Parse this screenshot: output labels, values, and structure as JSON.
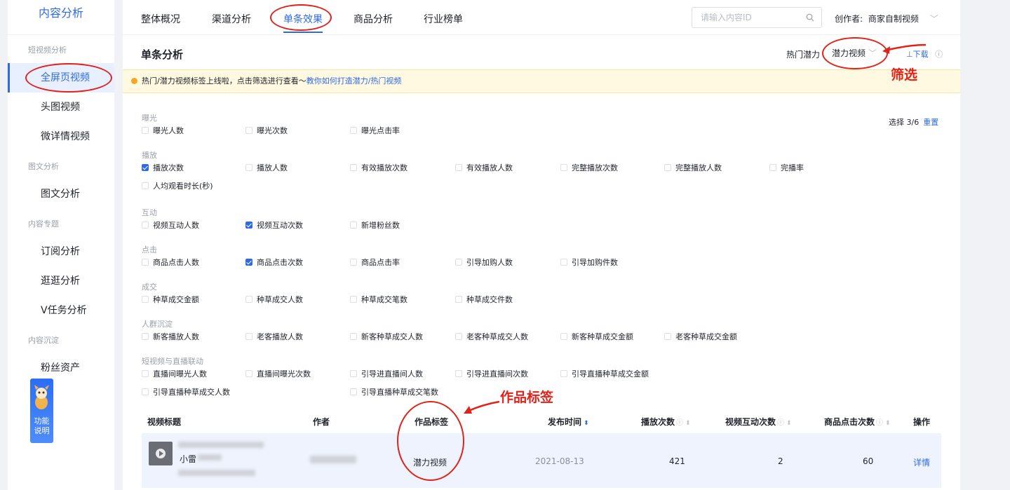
{
  "sidebar": {
    "title": "内容分析",
    "groups": [
      {
        "label": "短视频分析",
        "items": [
          "全屏页视频",
          "头图视频",
          "微详情视频"
        ]
      },
      {
        "label": "图文分析",
        "items": [
          "图文分析"
        ]
      },
      {
        "label": "内容专题",
        "items": [
          "订阅分析",
          "逛逛分析",
          "V任务分析"
        ]
      },
      {
        "label": "内容沉淀",
        "items": [
          "粉丝资产"
        ]
      }
    ],
    "active_item": "全屏页视频",
    "help_label": "功能\n说明"
  },
  "topnav": {
    "tabs": [
      "整体概况",
      "渠道分析",
      "单条效果",
      "商品分析",
      "行业榜单"
    ],
    "active_tab": "单条效果",
    "search_placeholder": "请输入内容ID",
    "creator_label": "创作者:",
    "creator_value": "商家自制视频"
  },
  "section": {
    "title": "单条分析",
    "hot_label": "热门潜力",
    "hot_value": "潜力视频",
    "download_label": "下载"
  },
  "notice": {
    "text": "热门/潜力视频标签上线啦，点击筛选进行查看～",
    "link": "教你如何打造潜力/热门视频"
  },
  "filters": {
    "select_count": "选择 3/6",
    "reset": "重置",
    "groups": [
      {
        "label": "曝光",
        "options": [
          [
            "曝光人数",
            false
          ],
          [
            "曝光次数",
            false
          ],
          [
            "曝光点击率",
            false
          ]
        ]
      },
      {
        "label": "播放",
        "options": [
          [
            "播放次数",
            true
          ],
          [
            "播放人数",
            false
          ],
          [
            "有效播放次数",
            false
          ],
          [
            "有效播放人数",
            false
          ],
          [
            "完整播放次数",
            false
          ],
          [
            "完整播放人数",
            false
          ],
          [
            "完播率",
            false
          ],
          [
            "人均观看时长(秒)",
            false
          ]
        ]
      },
      {
        "label": "互动",
        "options": [
          [
            "视频互动人数",
            false
          ],
          [
            "视频互动次数",
            true
          ],
          [
            "新增粉丝数",
            false
          ]
        ]
      },
      {
        "label": "点击",
        "options": [
          [
            "商品点击人数",
            false
          ],
          [
            "商品点击次数",
            true
          ],
          [
            "商品点击率",
            false
          ],
          [
            "引导加购人数",
            false
          ],
          [
            "引导加购件数",
            false
          ]
        ]
      },
      {
        "label": "成交",
        "options": [
          [
            "种草成交金额",
            false
          ],
          [
            "种草成交人数",
            false
          ],
          [
            "种草成交笔数",
            false
          ],
          [
            "种草成交件数",
            false
          ]
        ]
      },
      {
        "label": "人群沉淀",
        "options": [
          [
            "新客播放人数",
            false
          ],
          [
            "老客播放人数",
            false
          ],
          [
            "新客种草成交人数",
            false
          ],
          [
            "老客种草成交人数",
            false
          ],
          [
            "新客种草成交金额",
            false
          ],
          [
            "老客种草成交金额",
            false
          ]
        ]
      },
      {
        "label": "短视频与直播联动",
        "options": [
          [
            "直播间曝光人数",
            false
          ],
          [
            "直播间曝光次数",
            false
          ],
          [
            "引导进直播间人数",
            false
          ],
          [
            "引导进直播间次数",
            false
          ],
          [
            "引导直播种草成交金额",
            false
          ],
          [
            "引导直播种草成交人数",
            false
          ],
          [
            "引导直播种草成交笔数",
            false
          ]
        ]
      }
    ]
  },
  "table": {
    "columns": [
      "视频标题",
      "作者",
      "作品标签",
      "发布时间",
      "播放次数",
      "视频互动次数",
      "商品点击次数",
      "操作"
    ],
    "rows": [
      {
        "title_prefix": "小雷",
        "tag": "潜力视频",
        "date": "2021-08-13",
        "plays": "421",
        "interactions": "2",
        "clicks": "60",
        "action": "详情"
      }
    ]
  },
  "annotations": {
    "filter_label": "筛选",
    "tag_label": "作品标签"
  },
  "colors": {
    "accent": "#2f6ae5",
    "annotation": "#e0231a",
    "notice_bg": "#fff9e2"
  }
}
